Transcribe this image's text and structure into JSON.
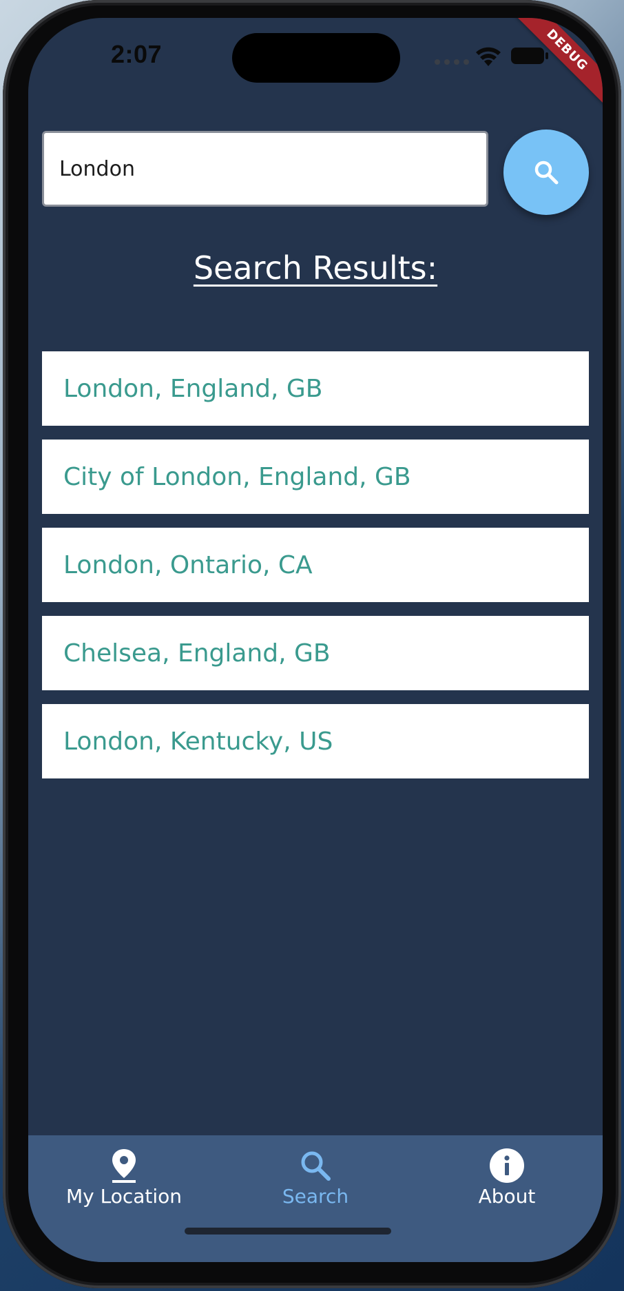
{
  "status_bar": {
    "time": "2:07"
  },
  "debug_banner": "DEBUG",
  "search": {
    "value": "London",
    "button_icon": "search-icon"
  },
  "results": {
    "title": "Search Results:",
    "items": [
      "London, England, GB",
      "City of London, England, GB",
      "London, Ontario, CA",
      "Chelsea, England, GB",
      "London, Kentucky, US"
    ]
  },
  "bottom_nav": {
    "items": [
      {
        "label": "My Location",
        "icon": "location-pin-icon",
        "active": false
      },
      {
        "label": "Search",
        "icon": "search-icon",
        "active": true
      },
      {
        "label": "About",
        "icon": "info-icon",
        "active": false
      }
    ]
  },
  "colors": {
    "background": "#24344d",
    "nav_background": "#3e5a80",
    "search_button": "#78c2f6",
    "result_text": "#3a9a8e",
    "nav_active": "#7ab8f0",
    "debug_banner": "#a5232b"
  }
}
